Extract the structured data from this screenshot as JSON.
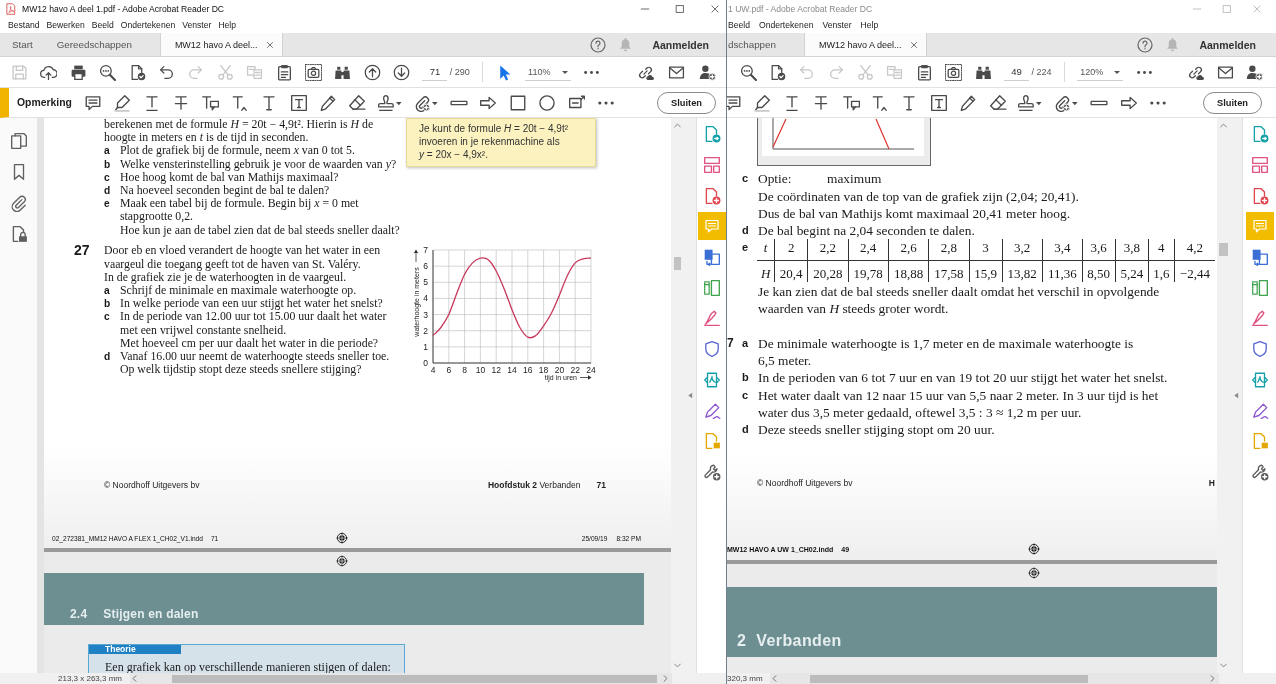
{
  "windows": [
    {
      "title": "MW12 havo A deel 1.pdf - Adobe Acrobat Reader DC",
      "active": true,
      "menu": [
        "Bestand",
        "Bewerken",
        "Beeld",
        "Ondertekenen",
        "Venster",
        "Help"
      ],
      "tabs": [
        {
          "label": "Start",
          "kind": "home",
          "selected": false
        },
        {
          "label": "Gereedschappen",
          "kind": "tools",
          "selected": false
        },
        {
          "label": "MW12 havo A deel...",
          "kind": "document",
          "selected": true
        }
      ],
      "sign_in": "Aanmelden",
      "toolbar": [
        {
          "kind": "save",
          "disabled": true
        },
        {
          "kind": "upload",
          "disabled": false
        },
        {
          "kind": "print",
          "disabled": false
        },
        {
          "kind": "zoom",
          "disabled": false
        },
        {
          "kind": "check",
          "disabled": false
        },
        {
          "kind": "undo",
          "disabled": false
        },
        {
          "kind": "redo",
          "disabled": true
        },
        {
          "kind": "cut",
          "disabled": true
        },
        {
          "kind": "copy",
          "disabled": true
        },
        {
          "kind": "clipboard",
          "disabled": false
        },
        {
          "kind": "snapshot",
          "disabled": false
        },
        {
          "kind": "binoculars",
          "disabled": false
        },
        {
          "kind": "up",
          "disabled": false
        },
        {
          "kind": "down",
          "disabled": false
        },
        {
          "kind": "page",
          "value": "71",
          "total": "/ 290"
        },
        {
          "kind": "pointer",
          "selected": true
        },
        {
          "kind": "zoomlevel",
          "value": "110%"
        },
        {
          "kind": "more"
        }
      ],
      "toolbar_right": [
        {
          "kind": "link"
        },
        {
          "kind": "mail"
        },
        {
          "kind": "user"
        }
      ],
      "comment_bar": {
        "label": "Opmerking",
        "tools": [
          {
            "kind": "comment"
          },
          {
            "kind": "highlight"
          },
          {
            "kind": "underline"
          },
          {
            "kind": "strike"
          },
          {
            "kind": "textnote"
          },
          {
            "kind": "insert"
          },
          {
            "kind": "text"
          },
          {
            "kind": "textbox"
          },
          {
            "kind": "pencil"
          },
          {
            "kind": "eraser"
          },
          {
            "kind": "stamp"
          },
          {
            "kind": "attach"
          },
          {
            "kind": "line"
          },
          {
            "kind": "arrow"
          },
          {
            "kind": "rect"
          },
          {
            "kind": "oval"
          },
          {
            "kind": "callout"
          },
          {
            "kind": "more"
          }
        ],
        "close": "Sluiten"
      },
      "nav_tools": [
        {
          "kind": "pages"
        },
        {
          "kind": "bookmark"
        },
        {
          "kind": "clip"
        },
        {
          "kind": "lock"
        }
      ],
      "side_tools": [
        {
          "kind": "export",
          "selected": false
        },
        {
          "kind": "organize",
          "selected": false
        },
        {
          "kind": "create",
          "selected": false
        },
        {
          "kind": "comment",
          "selected": true
        },
        {
          "kind": "combine",
          "selected": false
        },
        {
          "kind": "edit",
          "selected": false
        },
        {
          "kind": "fill",
          "selected": false
        },
        {
          "kind": "protect",
          "selected": false
        },
        {
          "kind": "scan",
          "selected": false
        },
        {
          "kind": "sign",
          "selected": false
        },
        {
          "kind": "page",
          "selected": false
        },
        {
          "kind": "tools",
          "selected": false
        }
      ],
      "document": {
        "kind": "exercises",
        "intro": "berekenen met de formule *H* = 20t − 4,9t². Hierin is *H* de\nhoogte in meters en *t* is de tijd in seconden.",
        "questions": [
          {
            "letter": "a",
            "paragraphs": [
              "Plot de grafiek bij de formule, neem *x* van 0 tot 5."
            ]
          },
          {
            "letter": "b",
            "paragraphs": [
              "Welke vensterinstelling gebruik je voor de waarden van *y*?"
            ]
          },
          {
            "letter": "c",
            "paragraphs": [
              "Hoe hoog komt de bal van Mathijs maximaal?"
            ]
          },
          {
            "letter": "d",
            "paragraphs": [
              "Na hoeveel seconden begint de bal te dalen?"
            ]
          },
          {
            "letter": "e",
            "paragraphs": [
              "Maak een tabel bij de formule. Begin bij *x* = 0 met\nstapgrootte 0,2.",
              "Hoe kun je aan de tabel zien dat de bal steeds sneller daalt?"
            ]
          }
        ],
        "note": "Je kunt de formule *H* = 20t − 4,9t²\ninvoeren in je rekenmachine als\n*y* = 20x − 4,9x².",
        "exercise": {
          "number": "27",
          "intro": "Door eb en vloed verandert de hoogte van het water in een\nvaargeul die toegang geeft tot de haven van St. Valéry.\nIn de grafiek zie je de waterhoogten in de vaargeul.",
          "questions": [
            {
              "letter": "a",
              "paragraphs": [
                "Schrijf de minimale en maximale waterhoogte op."
              ]
            },
            {
              "letter": "b",
              "paragraphs": [
                "In welke periode van een uur stijgt het water het snelst?"
              ]
            },
            {
              "letter": "c",
              "paragraphs": [
                "In de periode van 12.00 uur tot 15.00 uur daalt het water\nmet een vrijwel constante snelheid.",
                "Met hoeveel cm per uur daalt het water in die periode?"
              ]
            },
            {
              "letter": "d",
              "paragraphs": [
                "Vanaf 16.00 uur neemt de waterhoogte steeds sneller toe.",
                "Op welk tijdstip stopt deze steeds snellere stijging?"
              ]
            }
          ],
          "chart_data": {
            "type": "line",
            "xlabel": "tijd in uren",
            "ylabel": "waterhoogte in meters",
            "x": [
              4,
              5,
              6,
              7,
              8,
              9,
              10,
              11,
              12,
              13,
              14,
              15,
              16,
              17,
              18,
              19,
              20,
              21,
              22,
              23,
              24
            ],
            "values": [
              1.7,
              2.2,
              3.0,
              4.3,
              5.5,
              6.2,
              6.5,
              6.4,
              5.7,
              4.6,
              3.3,
              2.2,
              1.6,
              1.7,
              2.3,
              3.1,
              4.2,
              5.4,
              6.2,
              6.45,
              6.5
            ],
            "xlim": [
              4,
              24
            ],
            "ylim": [
              0,
              7
            ],
            "grid": true,
            "xticks": [
              {
                "value": 4,
                "label": "4"
              },
              {
                "value": 6,
                "label": "6"
              },
              {
                "value": 8,
                "label": "8"
              },
              {
                "value": 10,
                "label": "10"
              },
              {
                "value": 12,
                "label": "12"
              },
              {
                "value": 14,
                "label": "14"
              },
              {
                "value": 16,
                "label": "16"
              },
              {
                "value": 18,
                "label": "18"
              },
              {
                "value": 20,
                "label": "20"
              },
              {
                "value": 22,
                "label": "22"
              },
              {
                "value": 24,
                "label": "24"
              }
            ],
            "yticks": [
              {
                "value": 0,
                "label": "0"
              },
              {
                "value": 1,
                "label": "1"
              },
              {
                "value": 2,
                "label": "2"
              },
              {
                "value": 3,
                "label": "3"
              },
              {
                "value": 4,
                "label": "4"
              },
              {
                "value": 5,
                "label": "5"
              },
              {
                "value": 6,
                "label": "6"
              },
              {
                "value": 7,
                "label": "7"
              }
            ]
          }
        },
        "footer": {
          "publisher": "© Noordhoff Uitgevers bv",
          "chapter": "**Hoofdstuk 2** Verbanden",
          "page": "71"
        },
        "slug": {
          "file": "02_272381_MM12 HAVO A FLEX 1_CH02_V1.indd",
          "page": "71",
          "date": "25/09/19",
          "time": "8:32 PM"
        },
        "section": {
          "number": "2.4",
          "title": "Stijgen en dalen"
        },
        "theory": {
          "label": "Theorie",
          "text": "Een grafiek kan op verschillende manieren stijgen of dalen:"
        }
      },
      "status": "213,3 x 263,3 mm"
    },
    {
      "title": "1 UW.pdf - Adobe Acrobat Reader DC",
      "active": false,
      "menu": [
        "Beeld",
        "Ondertekenen",
        "Venster",
        "Help"
      ],
      "tabs": [
        {
          "label": "dschappen",
          "kind": "tools",
          "selected": false
        },
        {
          "label": "MW12 havo A deel...",
          "kind": "document",
          "selected": true
        }
      ],
      "sign_in": "Aanmelden",
      "toolbar": [
        {
          "kind": "zoom",
          "disabled": false
        },
        {
          "kind": "check",
          "disabled": false
        },
        {
          "kind": "undo",
          "disabled": true
        },
        {
          "kind": "redo",
          "disabled": true
        },
        {
          "kind": "cut",
          "disabled": true
        },
        {
          "kind": "copy",
          "disabled": true
        },
        {
          "kind": "clipboard",
          "disabled": false
        },
        {
          "kind": "snapshot",
          "disabled": false
        },
        {
          "kind": "binoculars",
          "disabled": false
        },
        {
          "kind": "page",
          "value": "49",
          "total": "/ 224"
        },
        {
          "kind": "zoomlevel",
          "value": "120%"
        },
        {
          "kind": "more"
        }
      ],
      "toolbar_right": [
        {
          "kind": "link"
        },
        {
          "kind": "mail"
        },
        {
          "kind": "user"
        }
      ],
      "comment_bar": {
        "tools": [
          {
            "kind": "comment"
          },
          {
            "kind": "highlight"
          },
          {
            "kind": "underline"
          },
          {
            "kind": "strike"
          },
          {
            "kind": "textnote"
          },
          {
            "kind": "insert"
          },
          {
            "kind": "text"
          },
          {
            "kind": "textbox"
          },
          {
            "kind": "pencil"
          },
          {
            "kind": "eraser"
          },
          {
            "kind": "stamp"
          },
          {
            "kind": "attach"
          },
          {
            "kind": "line"
          },
          {
            "kind": "arrow"
          },
          {
            "kind": "more"
          }
        ],
        "close": "Sluiten"
      },
      "side_tools": [
        {
          "kind": "export",
          "selected": false
        },
        {
          "kind": "organize",
          "selected": false
        },
        {
          "kind": "create",
          "selected": false
        },
        {
          "kind": "comment",
          "selected": true
        },
        {
          "kind": "combine",
          "selected": false
        },
        {
          "kind": "edit",
          "selected": false
        },
        {
          "kind": "fill",
          "selected": false
        },
        {
          "kind": "protect",
          "selected": false
        },
        {
          "kind": "scan",
          "selected": false
        },
        {
          "kind": "sign",
          "selected": false
        },
        {
          "kind": "page",
          "selected": false
        },
        {
          "kind": "tools",
          "selected": false
        }
      ],
      "document": {
        "kind": "answers",
        "answers": [
          {
            "letter": "c",
            "option": "Optie:",
            "option_value": "maximum",
            "paragraphs": [
              "De coördinaten van de top van de grafiek zijn (2,04; 20,41).",
              "Dus de bal van Mathijs komt maximaal 20,41 meter hoog."
            ]
          },
          {
            "letter": "d",
            "paragraphs": [
              "De bal begint na 2,04 seconden te dalen."
            ]
          },
          {
            "letter": "e",
            "table": [
              {
                "label": "t",
                "cells": [
                  "2",
                  "2,2",
                  "2,4",
                  "2,6",
                  "2,8",
                  "3",
                  "3,2",
                  "3,4",
                  "3,6",
                  "3,8",
                  "4",
                  "4,2"
                ]
              },
              {
                "label": "H",
                "cells": [
                  "20,4",
                  "20,28",
                  "19,78",
                  "18,88",
                  "17,58",
                  "15,9",
                  "13,82",
                  "11,36",
                  "8,50",
                  "5,24",
                  "1,6",
                  "−2,44"
                ]
              }
            ],
            "paragraphs": [
              "Je kan zien dat de bal steeds sneller daalt omdat het verschil in opvolgende\nwaarden van *H* steeds groter wordt."
            ]
          }
        ],
        "exercise": {
          "number": "7",
          "answers": [
            {
              "letter": "a",
              "paragraphs": [
                "De minimale waterhoogte is 1,7 meter en de maximale waterhoogte is\n6,5 meter."
              ]
            },
            {
              "letter": "b",
              "paragraphs": [
                "In de perioden van 6 tot 7 uur en van 19 tot 20 uur stijgt het water het snelst."
              ]
            },
            {
              "letter": "c",
              "paragraphs": [
                "Het water daalt van 12 naar 15 uur van 5,5 naar 2 meter. In 3 uur tijd is het\nwater dus 3,5 meter gedaald, oftewel 3,5 : 3 ≈ 1,2 m per uur."
              ]
            },
            {
              "letter": "d",
              "paragraphs": [
                "Deze steeds sneller stijging stopt om 20 uur."
              ]
            }
          ]
        },
        "footer": {
          "publisher": "© Noordhoff Uitgevers bv",
          "chapter": "**H**"
        },
        "slug": {
          "file": "MW12 HAVO A UW 1_CH02.indd",
          "page": "49"
        },
        "section": {
          "number": "2",
          "title": "Verbanden"
        }
      },
      "status": "320,3 mm"
    }
  ]
}
